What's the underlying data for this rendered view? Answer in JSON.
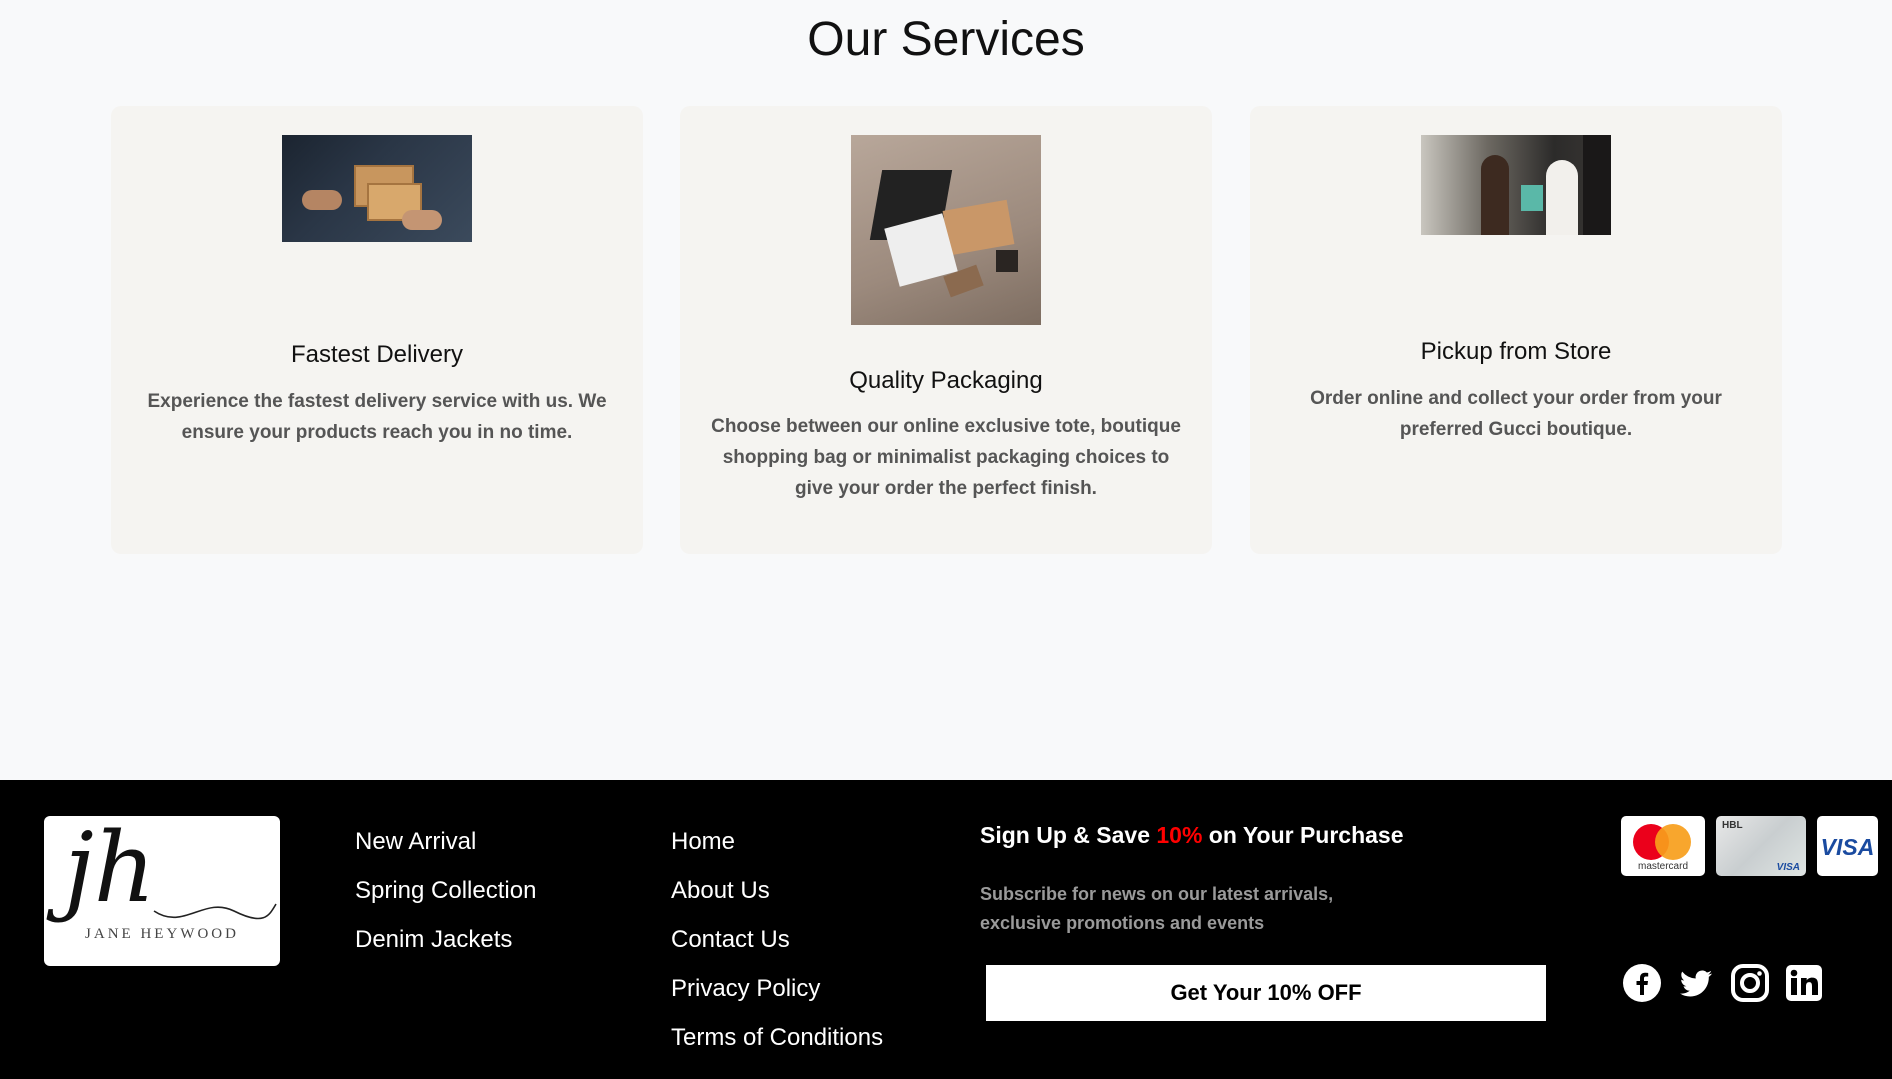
{
  "services": {
    "title": "Our Services",
    "cards": [
      {
        "title": "Fastest Delivery",
        "description": "Experience the fastest delivery service with us. We ensure your products reach you in no time.",
        "image_icon": "delivery-photo"
      },
      {
        "title": "Quality Packaging",
        "description": "Choose between our online exclusive tote, boutique shopping bag or minimalist packaging choices to give your order the perfect finish.",
        "image_icon": "packaging-photo"
      },
      {
        "title": "Pickup from Store",
        "description": "Order online and collect your order from your preferred Gucci boutique.",
        "image_icon": "store-photo"
      }
    ]
  },
  "footer": {
    "logo": {
      "mark": "jh",
      "name": "JANE HEYWOOD"
    },
    "links_col1": [
      "New Arrival",
      "Spring Collection",
      "Denim Jackets"
    ],
    "links_col2": [
      "Home",
      "About Us",
      "Contact Us",
      "Privacy Policy",
      "Terms of Conditions"
    ],
    "signup": {
      "title_pre": "Sign Up & Save ",
      "title_highlight": "10%",
      "title_post": " on Your Purchase",
      "subtitle": "Subscribe for news on our latest arrivals, exclusive promotions and events",
      "button_label": "Get Your 10% OFF",
      "highlight_color": "#ff0000"
    },
    "payments": [
      {
        "name": "mastercard",
        "label": "mastercard",
        "icon": "mastercard-icon"
      },
      {
        "name": "hbl",
        "label": "HBL",
        "sublabel": "VISA",
        "icon": "hbl-card-icon"
      },
      {
        "name": "visa",
        "label": "VISA",
        "icon": "visa-icon"
      }
    ],
    "social": [
      "facebook-icon",
      "twitter-icon",
      "instagram-icon",
      "linkedin-icon"
    ]
  }
}
